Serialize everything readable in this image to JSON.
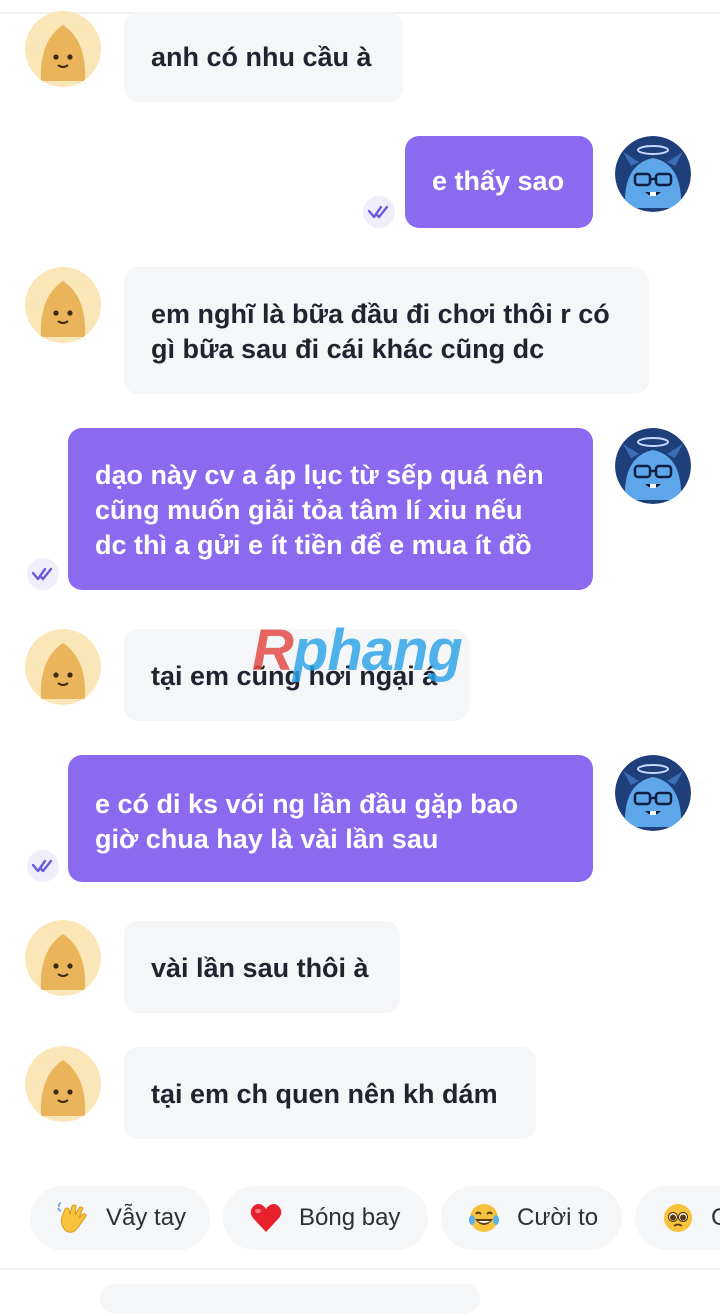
{
  "chat": {
    "messages": [
      {
        "side": "in",
        "lines": [
          "anh có nhu cầu à"
        ]
      },
      {
        "side": "out",
        "lines": [
          "e thấy sao"
        ]
      },
      {
        "side": "in",
        "lines": [
          "em nghĩ là bữa đầu đi chơi thôi r có",
          "gì bữa sau đi cái khác cũng dc"
        ]
      },
      {
        "side": "out",
        "lines": [
          "dạo này cv a áp lục từ sếp quá nên",
          "cũng muốn giải tỏa tâm lí xiu nếu",
          "dc thì a gửi e ít tiền để e mua ít đồ"
        ]
      },
      {
        "side": "in",
        "lines": [
          "tại em cũng hơi ngại á"
        ]
      },
      {
        "side": "out",
        "lines": [
          "e có di ks vói ng lần đầu gặp bao",
          "giờ chua hay là vài lần sau"
        ]
      },
      {
        "side": "in",
        "lines": [
          "vài lần sau thôi à"
        ]
      },
      {
        "side": "in",
        "lines": [
          "tại em ch quen nên kh dám"
        ]
      }
    ]
  },
  "watermark": {
    "first": "R",
    "rest": "phang"
  },
  "quick_reactions": [
    {
      "label": "Vẫy tay",
      "icon": "waving-hand-icon"
    },
    {
      "label": "Bóng bay",
      "icon": "red-heart-icon"
    },
    {
      "label": "Cười to",
      "icon": "tears-of-joy-icon"
    },
    {
      "label": "C",
      "icon": "pleading-face-icon"
    }
  ],
  "colors": {
    "outgoing": "#8b6af0",
    "incoming": "#f5f6f8",
    "accent": "#8b6af0"
  }
}
